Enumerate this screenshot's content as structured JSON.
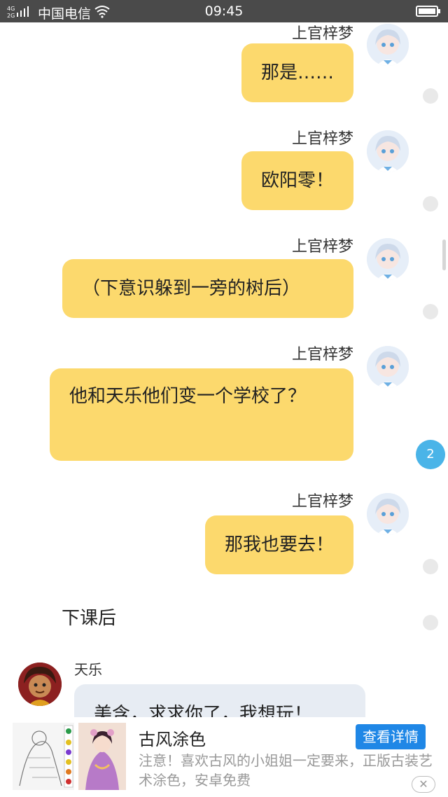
{
  "status_bar": {
    "carrier": "中国电信",
    "time": "09:45",
    "network": "4G 2G"
  },
  "chat": {
    "messages_out": [
      {
        "sender": "上官梓梦",
        "text": "那是……"
      },
      {
        "sender": "上官梓梦",
        "text": "欧阳零！"
      },
      {
        "sender": "上官梓梦",
        "text": "（下意识躲到一旁的树后）"
      },
      {
        "sender": "上官梓梦",
        "text": "他和天乐他们变一个学校了？"
      },
      {
        "sender": "上官梓梦",
        "text": "那我也要去！"
      }
    ],
    "narration": "下课后",
    "message_in": {
      "sender": "天乐",
      "text": "美含，求求你了，我想玩！"
    },
    "unread_badge": "2"
  },
  "ad": {
    "title": "古风涂色",
    "button_label": "查看详情",
    "description": "注意！喜欢古风的小姐姐一定要来，正版古装艺术涂色，安卓免费",
    "close_icon": "close-icon"
  },
  "colors": {
    "status_bar_bg": "#4a4a4a",
    "outgoing_bubble": "#fcd96d",
    "incoming_bubble": "#e7ecf3",
    "badge": "#4ab4e8",
    "ad_button": "#1f87e6"
  }
}
